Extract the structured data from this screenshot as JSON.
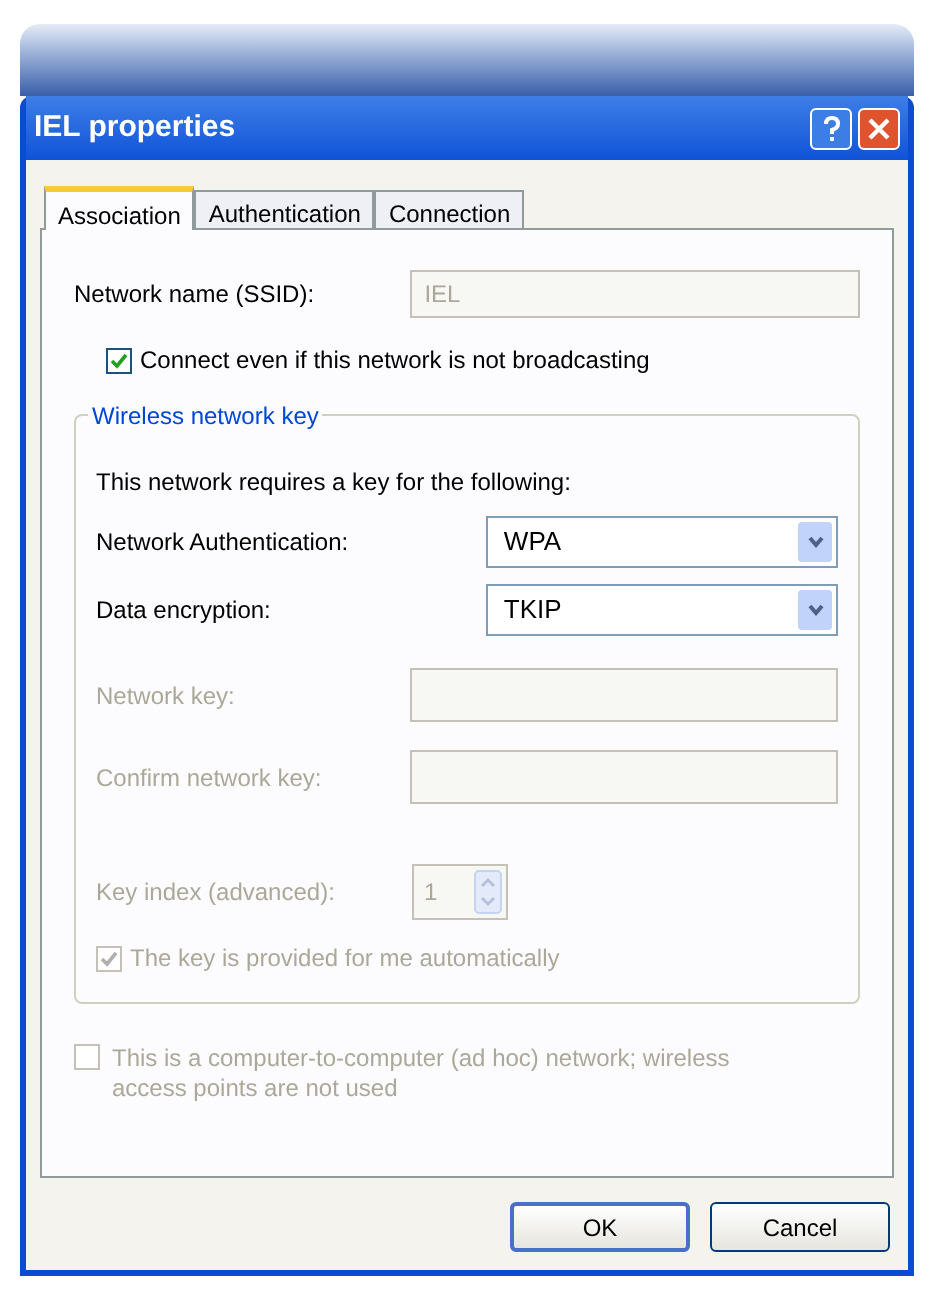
{
  "window": {
    "title": "IEL properties"
  },
  "tabs": [
    {
      "label": "Association",
      "selected": true
    },
    {
      "label": "Authentication",
      "selected": false
    },
    {
      "label": "Connection",
      "selected": false
    }
  ],
  "ssid": {
    "label": "Network name (SSID):",
    "value": "IEL",
    "disabled": true
  },
  "hidden_network": {
    "label": "Connect even if this network is not broadcasting",
    "checked": true,
    "disabled": false
  },
  "key_group": {
    "title": "Wireless network key",
    "intro": "This network requires a key for the following:",
    "selects": [
      {
        "label": "Network Authentication:",
        "value": "WPA"
      },
      {
        "label": "Data encryption:",
        "value": "TKIP"
      }
    ],
    "key_fields": [
      {
        "label": "Network key:",
        "disabled": true
      },
      {
        "label": "Confirm network key:",
        "disabled": true
      }
    ],
    "key_index": {
      "label": "Key index (advanced):",
      "value": "1",
      "disabled": true
    },
    "auto_key": {
      "label": "The key is provided for me automatically",
      "checked": true,
      "disabled": true
    }
  },
  "adhoc": {
    "label": "This is a computer-to-computer (ad hoc) network; wireless access points are not used",
    "checked": false,
    "disabled": true
  },
  "buttons": [
    {
      "label": "OK",
      "default": true
    },
    {
      "label": "Cancel",
      "default": false
    }
  ]
}
